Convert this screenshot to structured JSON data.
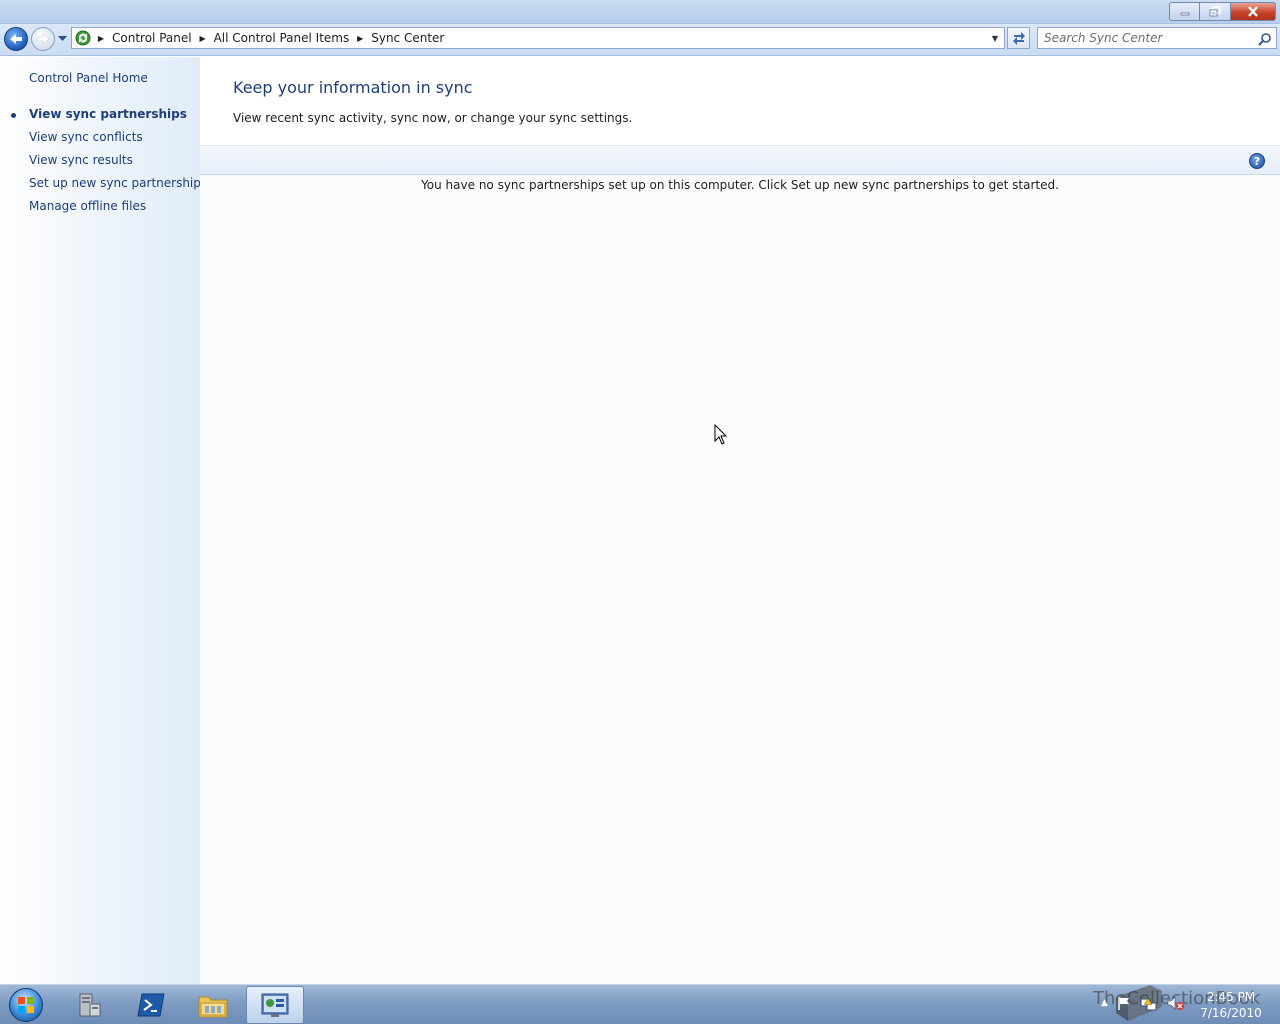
{
  "window": {
    "controls": {
      "minimize": "minimize",
      "restore": "restore",
      "close": "close"
    }
  },
  "navbar": {
    "breadcrumbs": [
      "Control Panel",
      "All Control Panel Items",
      "Sync Center"
    ],
    "search_placeholder": "Search Sync Center"
  },
  "sidebar": {
    "home": "Control Panel Home",
    "items": [
      {
        "label": "View sync partnerships",
        "active": true
      },
      {
        "label": "View sync conflicts",
        "active": false
      },
      {
        "label": "View sync results",
        "active": false
      },
      {
        "label": "Set up new sync partnerships",
        "active": false
      },
      {
        "label": "Manage offline files",
        "active": false
      }
    ]
  },
  "main": {
    "title": "Keep your information in sync",
    "subtitle": "View recent sync activity, sync now, or change your sync settings.",
    "empty_message": "You have no sync partnerships set up on this computer. Click Set up new sync partnerships to get started.",
    "help_glyph": "?"
  },
  "taskbar": {
    "buttons": [
      "server-manager-icon",
      "powershell-icon",
      "explorer-folder-icon",
      "control-panel-icon"
    ],
    "watermark": "TheCollectionBook",
    "clock_time": "2:45 PM",
    "clock_date": "7/16/2010"
  },
  "colors": {
    "link": "#1e3e7b",
    "title_blue": "#1e3e7b",
    "close_red": "#c7432a",
    "taskbar": "#7f9cc2"
  }
}
